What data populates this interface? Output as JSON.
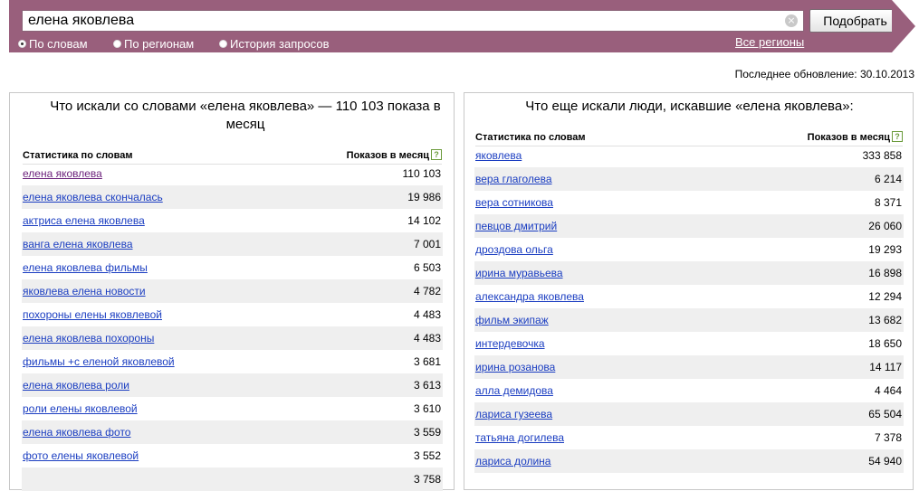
{
  "search": {
    "query": "елена яковлева",
    "submit_label": "Подобрать"
  },
  "modes": [
    {
      "label": "По словам",
      "checked": true
    },
    {
      "label": "По регионам",
      "checked": false
    },
    {
      "label": "История запросов",
      "checked": false
    }
  ],
  "regions_link": "Все регионы",
  "last_update": "Последнее обновление: 30.10.2013",
  "left_panel": {
    "title": "Что искали со словами «елена яковлева» — 110 103 показа в месяц",
    "col_keyword": "Статистика по словам",
    "col_count": "Показов в месяц",
    "help": "?",
    "rows": [
      {
        "keyword": "елена яковлева",
        "count": "110 103"
      },
      {
        "keyword": "елена яковлева скончалась",
        "count": "19 986"
      },
      {
        "keyword": "актриса елена яковлева",
        "count": "14 102"
      },
      {
        "keyword": "ванга елена яковлева",
        "count": "7 001"
      },
      {
        "keyword": "елена яковлева фильмы",
        "count": "6 503"
      },
      {
        "keyword": "яковлева елена новости",
        "count": "4 782"
      },
      {
        "keyword": "похороны елены яковлевой",
        "count": "4 483"
      },
      {
        "keyword": "елена яковлева похороны",
        "count": "4 483"
      },
      {
        "keyword": "фильмы +с еленой яковлевой",
        "count": "3 681"
      },
      {
        "keyword": "елена яковлева роли",
        "count": "3 613"
      },
      {
        "keyword": "роли елены яковлевой",
        "count": "3 610"
      },
      {
        "keyword": "елена яковлева фото",
        "count": "3 559"
      },
      {
        "keyword": "фото елены яковлевой",
        "count": "3 552"
      },
      {
        "keyword": "",
        "count": "3 758"
      }
    ]
  },
  "right_panel": {
    "title": "Что еще искали люди, искавшие «елена яковлева»:",
    "col_keyword": "Статистика по словам",
    "col_count": "Показов в месяц",
    "help": "?",
    "rows": [
      {
        "keyword": "яковлева",
        "count": "333 858"
      },
      {
        "keyword": "вера глаголева",
        "count": "6 214"
      },
      {
        "keyword": "вера сотникова",
        "count": "8 371"
      },
      {
        "keyword": "певцов дмитрий",
        "count": "26 060"
      },
      {
        "keyword": "дроздова ольга",
        "count": "19 293"
      },
      {
        "keyword": "ирина муравьева",
        "count": "16 898"
      },
      {
        "keyword": "александра яковлева",
        "count": "12 294"
      },
      {
        "keyword": "фильм экипаж",
        "count": "13 682"
      },
      {
        "keyword": "интердевочка",
        "count": "18 650"
      },
      {
        "keyword": "ирина розанова",
        "count": "14 117"
      },
      {
        "keyword": "алла демидова",
        "count": "4 464"
      },
      {
        "keyword": "лариса гузеева",
        "count": "65 504"
      },
      {
        "keyword": "татьяна догилева",
        "count": "7 378"
      },
      {
        "keyword": "лариса долина",
        "count": "54 940"
      }
    ]
  },
  "colors": {
    "header": "#995f7c",
    "link": "#1a3dc1",
    "visited": "#6a1f7a"
  },
  "icons": [
    "clear-icon",
    "help-icon",
    "radio-icon"
  ]
}
